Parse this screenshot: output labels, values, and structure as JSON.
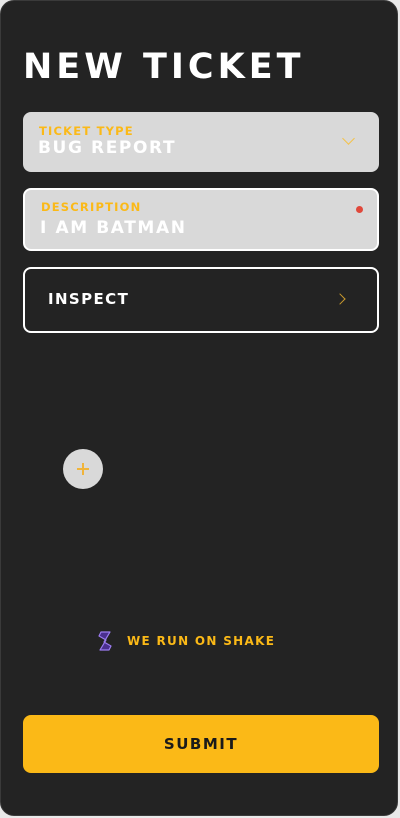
{
  "header": {
    "title": "NEW TICKET"
  },
  "ticket_type": {
    "label": "TICKET TYPE",
    "value": "BUG REPORT",
    "icon": "chevron-down-icon"
  },
  "description": {
    "label": "DESCRIPTION",
    "value": "I AM BATMAN",
    "required_indicator_color": "#e0483b"
  },
  "inspect": {
    "label": "INSPECT",
    "icon": "chevron-right-icon"
  },
  "attachment": {
    "icon": "plus-icon"
  },
  "branding": {
    "text": "WE RUN ON SHAKE",
    "icon": "shake-logo-icon"
  },
  "actions": {
    "submit_label": "SUBMIT"
  },
  "colors": {
    "background": "#232323",
    "accent": "#fbb917",
    "field_background": "#d9d9d9",
    "text": "#ffffff"
  }
}
